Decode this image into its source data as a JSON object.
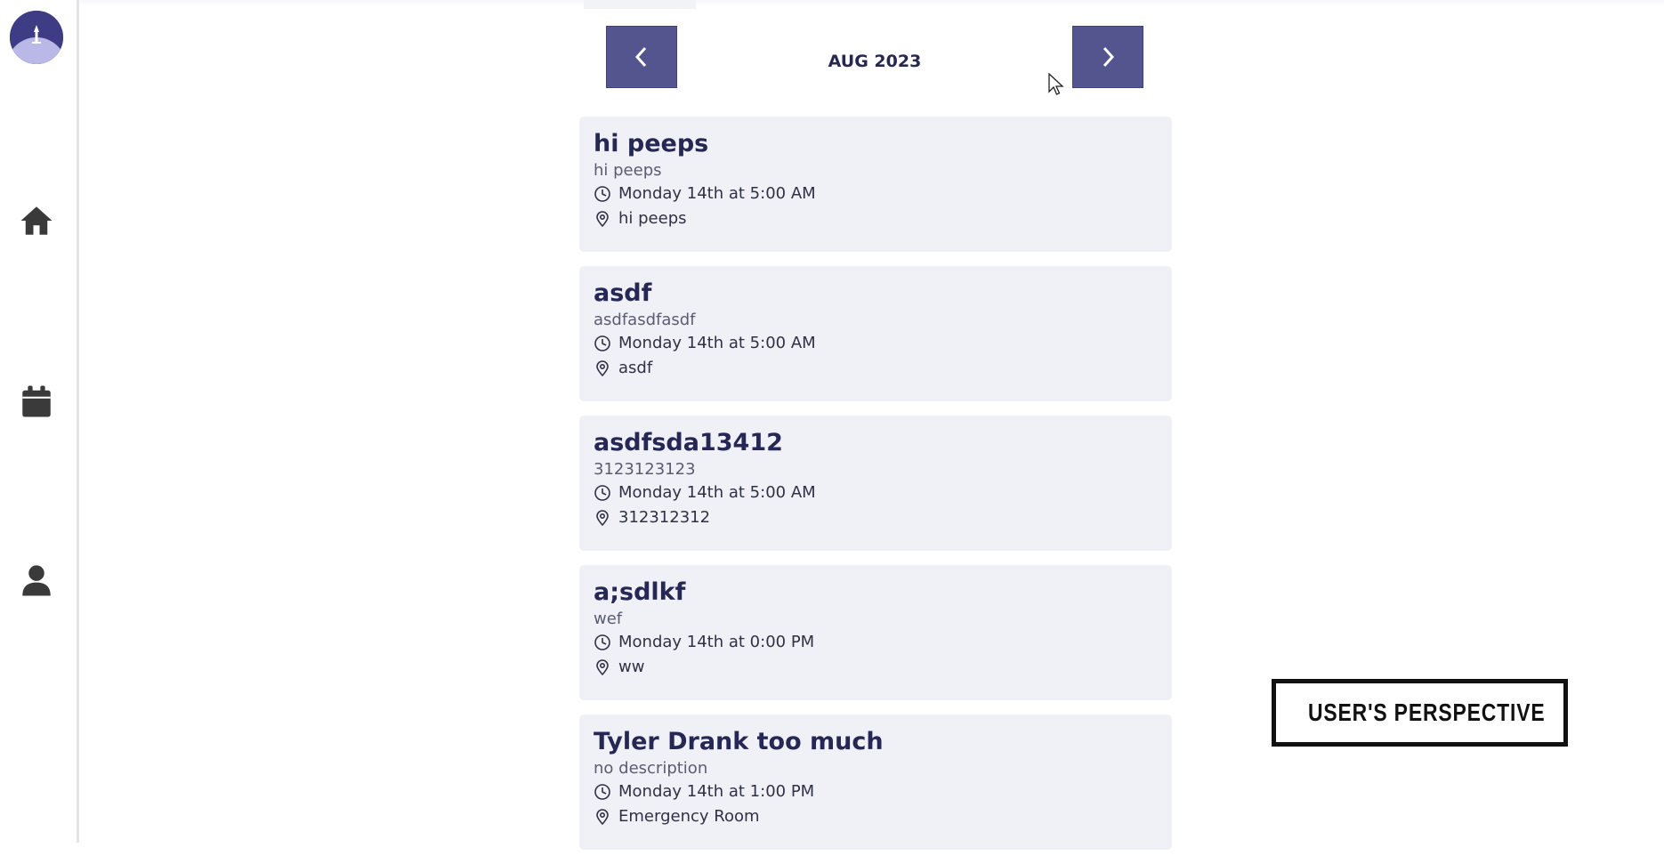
{
  "sidebar": {
    "avatar_icon": "tower-night-avatar",
    "nav": [
      {
        "icon": "home-icon"
      },
      {
        "icon": "calendar-icon"
      },
      {
        "icon": "user-icon"
      }
    ]
  },
  "calendar": {
    "month_label": "AUG 2023",
    "prev_icon": "chevron-left-icon",
    "next_icon": "chevron-right-icon"
  },
  "events": [
    {
      "title": "hi peeps",
      "description": "hi peeps",
      "time": "Monday 14th at 5:00 AM",
      "location": "hi peeps"
    },
    {
      "title": "asdf",
      "description": "asdfasdfasdf",
      "time": "Monday 14th at 5:00 AM",
      "location": "asdf"
    },
    {
      "title": "asdfsda13412",
      "description": "3123123123",
      "time": "Monday 14th at 5:00 AM",
      "location": "312312312"
    },
    {
      "title": "a;sdlkf",
      "description": "wef",
      "time": "Monday 14th at 0:00 PM",
      "location": "ww"
    },
    {
      "title": "Tyler Drank too much",
      "description": "no description",
      "time": "Monday 14th at 1:00 PM",
      "location": "Emergency Room"
    }
  ],
  "overlay": {
    "label": "USER'S PERSPECTIVE",
    "icon": "eye-icon"
  },
  "colors": {
    "accent": "#54548f",
    "card_bg": "#eff1f6",
    "title": "#262754"
  }
}
